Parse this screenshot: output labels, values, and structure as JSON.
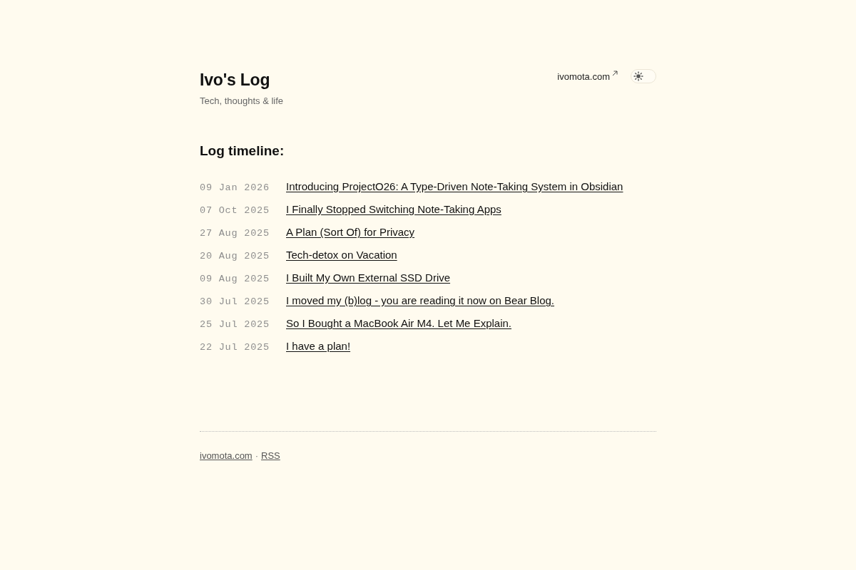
{
  "header": {
    "title": "Ivo's Log",
    "tagline": "Tech, thoughts & life",
    "site_link": "ivomota.com",
    "theme_toggle": {
      "dark": false
    }
  },
  "timeline": {
    "heading": "Log timeline:",
    "posts": [
      {
        "date": "09 Jan 2026",
        "title": "Introducing ProjectO26: A Type-Driven Note-Taking System in Obsidian"
      },
      {
        "date": "07 Oct 2025",
        "title": "I Finally Stopped Switching Note-Taking Apps"
      },
      {
        "date": "27 Aug 2025",
        "title": "A Plan (Sort Of) for Privacy"
      },
      {
        "date": "20 Aug 2025",
        "title": "Tech-detox on Vacation"
      },
      {
        "date": "09 Aug 2025",
        "title": "I Built My Own External SSD Drive"
      },
      {
        "date": "30 Jul 2025",
        "title": "I moved my (b)log - you are reading it now on Bear Blog."
      },
      {
        "date": "25 Jul 2025",
        "title": "So I Bought a MacBook Air M4. Let Me Explain."
      },
      {
        "date": "22 Jul 2025",
        "title": "I have a plan!"
      }
    ]
  },
  "footer": {
    "links": [
      "ivomota.com",
      "RSS"
    ],
    "separator": "·"
  }
}
